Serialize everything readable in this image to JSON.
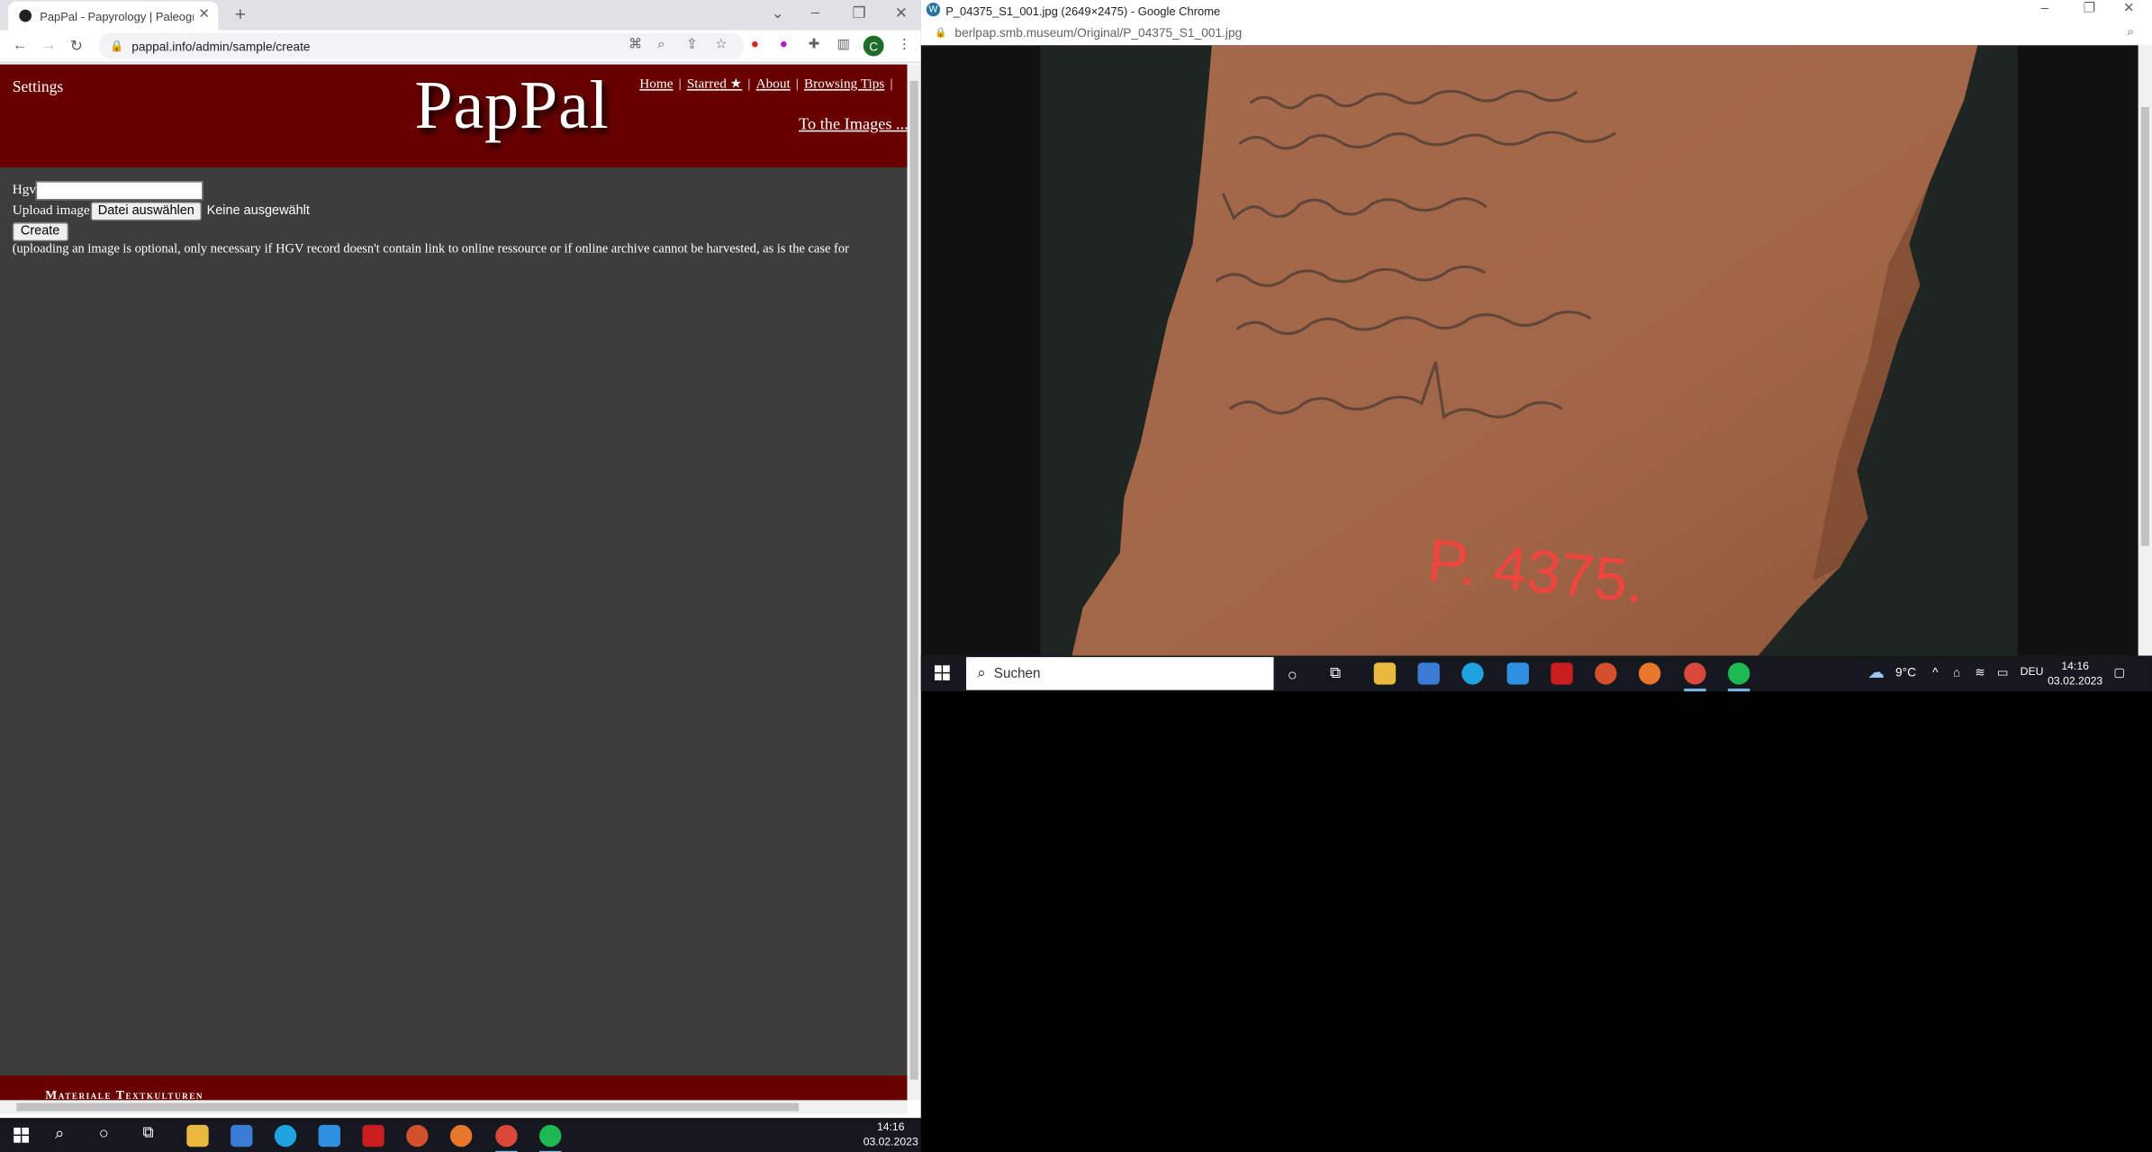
{
  "left_browser": {
    "tab_title": "PapPal - Papyrology | Paleograph",
    "address": "pappal.info/admin/sample/create",
    "profile_initial": "C"
  },
  "pappal": {
    "settings": "Settings",
    "logo": "PapPal",
    "nav": [
      "Home",
      "Starred ★",
      "About",
      "Browsing Tips"
    ],
    "to_images": "To the Images ...",
    "hgv_label": "Hgv",
    "upload_label": "Upload image",
    "file_button": "Datei auswählen",
    "no_file": "Keine ausgewählt",
    "create_button": "Create",
    "note": "(uploading an image is optional, only necessary if HGV record doesn't contain link to online ressource or if online archive cannot be harvested, as is the case for",
    "footer": "Materiale Textkulturen"
  },
  "right_browser": {
    "title": "P_04375_S1_001.jpg (2649×2475) - Google Chrome",
    "address": "berlpap.smb.museum/Original/P_04375_S1_001.jpg",
    "ostracon_label": "P. 4375."
  },
  "taskbar_right": {
    "search_placeholder": "Suchen",
    "weather": "9°C",
    "language": "DEU",
    "time": "14:16",
    "date": "03.02.2023"
  },
  "taskbar_bottom": {
    "time": "14:16",
    "date": "03.02.2023"
  },
  "colors": {
    "banner": "#680000",
    "page_bg": "#3d3d3d",
    "ostracon": "#a26647",
    "label_red": "#f0453e"
  }
}
